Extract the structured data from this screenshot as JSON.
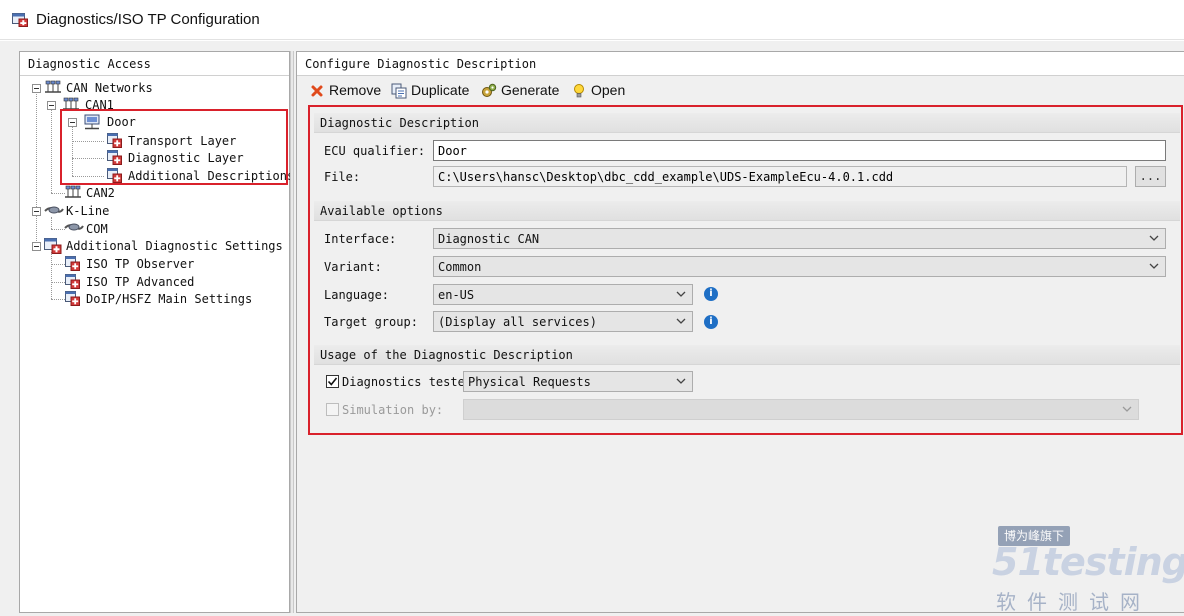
{
  "window": {
    "title": "Diagnostics/ISO TP Configuration"
  },
  "left_panel": {
    "header": "Diagnostic Access",
    "tree": {
      "can_networks": "CAN Networks",
      "can1": "CAN1",
      "door": "Door",
      "transport_layer": "Transport Layer",
      "diagnostic_layer": "Diagnostic Layer",
      "additional_descriptions": "Additional Descriptions",
      "can2": "CAN2",
      "k_line": "K-Line",
      "com": "COM",
      "additional_diagnostic_settings": "Additional Diagnostic Settings",
      "iso_tp_observer": "ISO TP Observer",
      "iso_tp_advanced": "ISO TP Advanced",
      "doip_hsfz": "DoIP/HSFZ Main Settings"
    }
  },
  "right_panel": {
    "header": "Configure Diagnostic Description",
    "toolbar": {
      "remove": "Remove",
      "duplicate": "Duplicate",
      "generate": "Generate",
      "open": "Open"
    },
    "diag_description": {
      "section_title": "Diagnostic Description",
      "ecu_qualifier_label": "ECU qualifier:",
      "ecu_qualifier_value": "Door",
      "file_label": "File:",
      "file_value": "C:\\Users\\hansc\\Desktop\\dbc_cdd_example\\UDS-ExampleEcu-4.0.1.cdd",
      "browse_label": "..."
    },
    "available_options": {
      "section_title": "Available options",
      "interface_label": "Interface:",
      "interface_value": "Diagnostic CAN",
      "variant_label": "Variant:",
      "variant_value": "Common",
      "language_label": "Language:",
      "language_value": "en-US",
      "target_group_label": "Target group:",
      "target_group_value": "(Display all services)"
    },
    "usage": {
      "section_title": "Usage of the Diagnostic Description",
      "diagnostics_tester_label": "Diagnostics tester",
      "diagnostics_tester_checked": true,
      "diagnostics_tester_value": "Physical Requests",
      "simulation_label": "Simulation by:",
      "simulation_checked": false,
      "simulation_value": ""
    }
  },
  "colors": {
    "highlight_red": "#d9212b",
    "info_blue": "#1f6fc5"
  },
  "watermark": {
    "badge": "博为峰旗下",
    "logo": "51testing",
    "subtitle": "软件测试网"
  }
}
